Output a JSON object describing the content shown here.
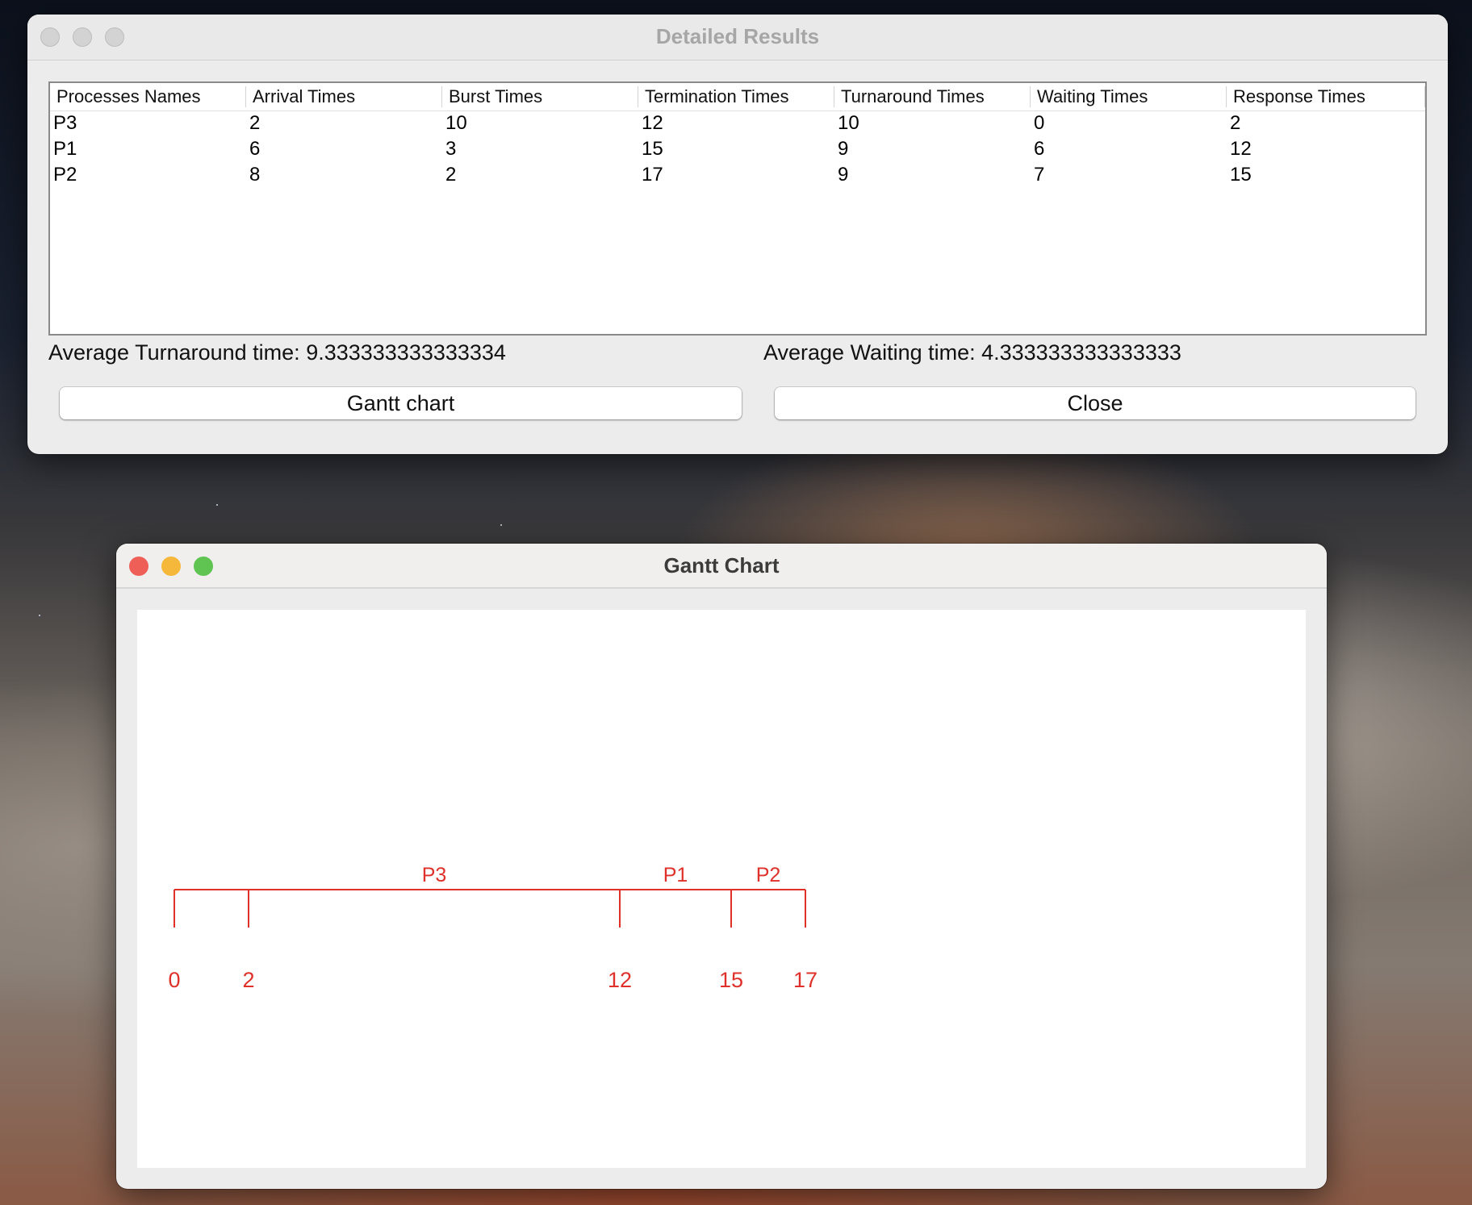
{
  "results_window": {
    "title": "Detailed Results",
    "table": {
      "columns": [
        "Processes Names",
        "Arrival Times",
        "Burst Times",
        "Termination Times",
        "Turnaround Times",
        "Waiting Times",
        "Response Times"
      ],
      "rows": [
        [
          "P3",
          "2",
          "10",
          "12",
          "10",
          "0",
          "2"
        ],
        [
          "P1",
          "6",
          "3",
          "15",
          "9",
          "6",
          "12"
        ],
        [
          "P2",
          "8",
          "2",
          "17",
          "9",
          "7",
          "15"
        ]
      ]
    },
    "avg_turnaround": "Average Turnaround time: 9.333333333333334",
    "avg_waiting": "Average Waiting time: 4.333333333333333",
    "gantt_button": "Gantt chart",
    "close_button": "Close"
  },
  "gantt_window": {
    "title": "Gantt Chart",
    "chart_data": {
      "type": "gantt",
      "segments": [
        {
          "label": "P3",
          "start": 2,
          "end": 12
        },
        {
          "label": "P1",
          "start": 12,
          "end": 15
        },
        {
          "label": "P2",
          "start": 15,
          "end": 17
        }
      ],
      "ticks": [
        0,
        2,
        12,
        15,
        17
      ],
      "color": "#e0302a"
    }
  },
  "colors": {
    "traffic_close": "#ee5f57",
    "traffic_minimize": "#f5b83a",
    "traffic_zoom": "#5fc451",
    "inactive_traffic": "#d3d3d3"
  }
}
